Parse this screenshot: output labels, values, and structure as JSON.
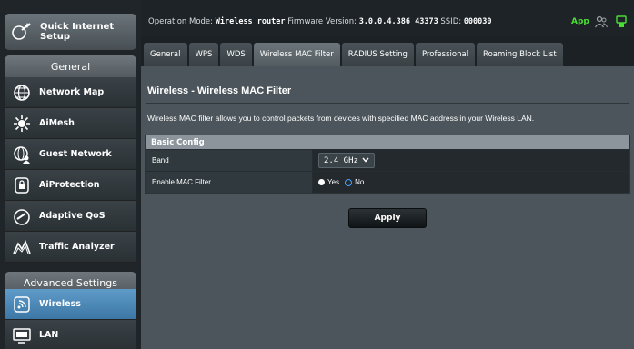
{
  "sidebar": {
    "quick_setup": {
      "label": "Quick Internet\nSetup",
      "icon": "wand-icon"
    },
    "general_header": "General",
    "general_items": [
      {
        "label": "Network Map",
        "icon": "globe-icon"
      },
      {
        "label": "AiMesh",
        "icon": "mesh-icon"
      },
      {
        "label": "Guest Network",
        "icon": "guest-globe-icon"
      },
      {
        "label": "AiProtection",
        "icon": "lock-icon"
      },
      {
        "label": "Adaptive QoS",
        "icon": "speedometer-icon"
      },
      {
        "label": "Traffic Analyzer",
        "icon": "traffic-icon"
      }
    ],
    "advanced_header": "Advanced Settings",
    "advanced_items": [
      {
        "label": "Wireless",
        "icon": "wifi-icon",
        "active": true
      },
      {
        "label": "LAN",
        "icon": "monitor-icon"
      }
    ]
  },
  "topbar": {
    "op_mode_label": "Operation Mode:",
    "op_mode_value": "Wireless router",
    "fw_label": "Firmware Version:",
    "fw_value": "3.0.0.4.386_43373",
    "ssid_label": "SSID:",
    "ssid_value": "000030",
    "app_label": "App"
  },
  "tabs": [
    {
      "label": "General"
    },
    {
      "label": "WPS"
    },
    {
      "label": "WDS"
    },
    {
      "label": "Wireless MAC Filter",
      "active": true
    },
    {
      "label": "RADIUS Setting"
    },
    {
      "label": "Professional"
    },
    {
      "label": "Roaming Block List"
    }
  ],
  "main": {
    "title": "Wireless - Wireless MAC Filter",
    "description": "Wireless MAC filter allows you to control packets from devices with specified MAC address in your Wireless LAN.",
    "config_header": "Basic Config",
    "band_label": "Band",
    "band_value": "2.4 GHz",
    "mac_filter_label": "Enable MAC Filter",
    "yes_label": "Yes",
    "no_label": "No",
    "mac_filter_selected": "Yes",
    "apply_label": "Apply"
  },
  "colors": {
    "active_menu": "#4a86b4",
    "app_green": "#4ade35",
    "radio_blue": "#4aa3ff"
  }
}
